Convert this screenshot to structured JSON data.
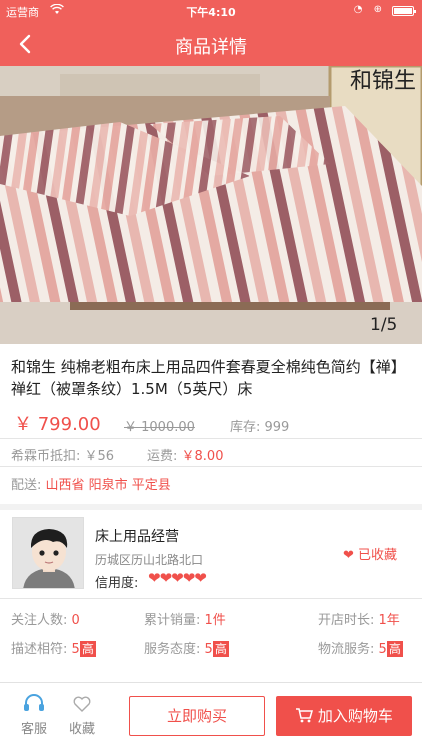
{
  "status_bar": {
    "carrier": "运营商",
    "time": "下午4:10",
    "battery_level": 0.9
  },
  "nav": {
    "title": "商品详情"
  },
  "gallery": {
    "image_label": "和锦生",
    "counter": "1/5"
  },
  "product": {
    "title": "和锦生 纯棉老粗布床上用品四件套春夏全棉纯色简约【禅】禅红（被罩条纹）1.5M（5英尺）床",
    "price": "￥ 799.00",
    "old_price": "￥ 1000.00",
    "stock": "库存: 999",
    "coin_label": "希霖币抵扣:",
    "coin_value": "￥56",
    "shipping_label": "运费:",
    "shipping_value": "￥8.00",
    "delivery_label": "配送:",
    "delivery_value": "山西省 阳泉市 平定县"
  },
  "store": {
    "name": "床上用品经营",
    "address": "历城区历山北路北口",
    "credit_label": "信用度:",
    "credit_hearts": "❤❤❤❤❤",
    "favorite_status": "已收藏",
    "followers_label": "关注人数:",
    "followers_value": "0",
    "sales_label": "累计销量:",
    "sales_value": "1件",
    "age_label": "开店时长:",
    "age_value": "1年",
    "desc_label": "描述相符:",
    "desc_score": "5",
    "service_label": "服务态度:",
    "service_score": "5",
    "logistics_label": "物流服务:",
    "logistics_score": "5",
    "rating_word": "高"
  },
  "bottom": {
    "service_label": "客服",
    "favorite_label": "收藏",
    "buy_label": "立即购买",
    "cart_label": "加入购物车"
  },
  "colors": {
    "accent": "#f0605b",
    "price": "#f0504b"
  },
  "icons": [
    "back-arrow-icon",
    "wifi-icon",
    "heart-icon",
    "headset-icon",
    "heart-outline-icon",
    "cart-icon"
  ]
}
